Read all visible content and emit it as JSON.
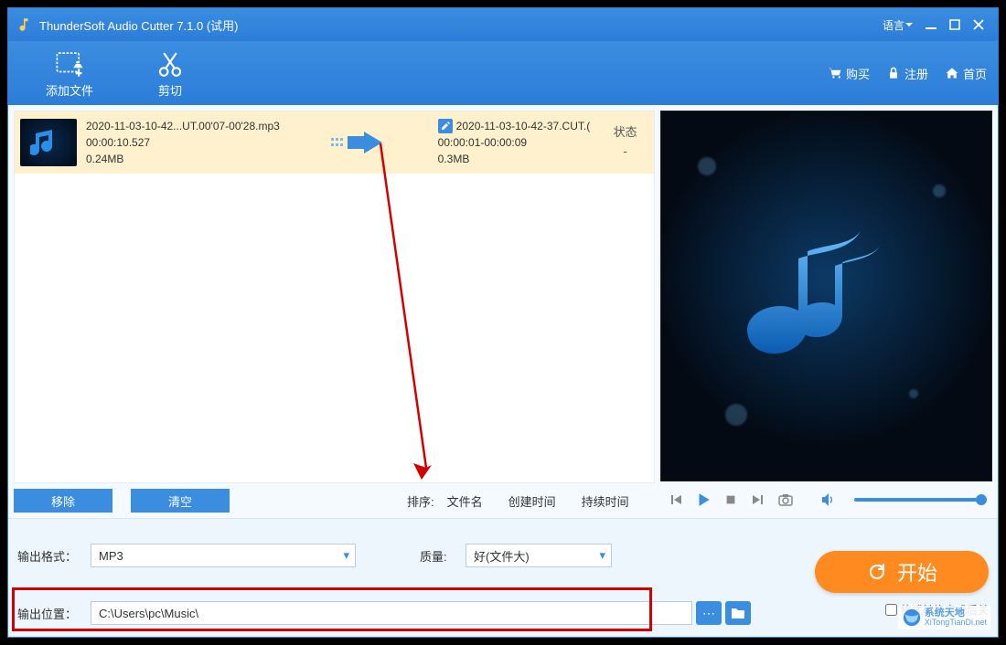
{
  "titlebar": {
    "title": "ThunderSoft Audio Cutter 7.1.0 (试用)",
    "language_label": "语言"
  },
  "toolbar": {
    "add_file": "添加文件",
    "cut": "剪切",
    "buy": "购买",
    "register": "注册",
    "home": "首页"
  },
  "filelist": {
    "source": {
      "name": "2020-11-03-10-42...UT.00'07-00'28.mp3",
      "duration": "00:00:10.527",
      "size": "0.24MB"
    },
    "output": {
      "name": "2020-11-03-10-42-37.CUT.(",
      "range": "00:00:01-00:00:09",
      "size": "0.3MB"
    },
    "status_header": "状态",
    "status_value": "-"
  },
  "listfooter": {
    "remove": "移除",
    "clear": "清空",
    "sort_label": "排序:",
    "sort_filename": "文件名",
    "sort_created": "创建时间",
    "sort_duration": "持续时间"
  },
  "bottom": {
    "format_label": "输出格式：",
    "format_value": "MP3",
    "quality_label": "质量:",
    "quality_value": "好(文件大)",
    "path_label": "输出位置：",
    "path_value": "C:\\Users\\pc\\Music\\",
    "start_label": "开始",
    "close_after_label": "格式转换完成后关"
  },
  "watermark": {
    "line1": "系统天地",
    "line2": "XiTongTianDi.net"
  }
}
